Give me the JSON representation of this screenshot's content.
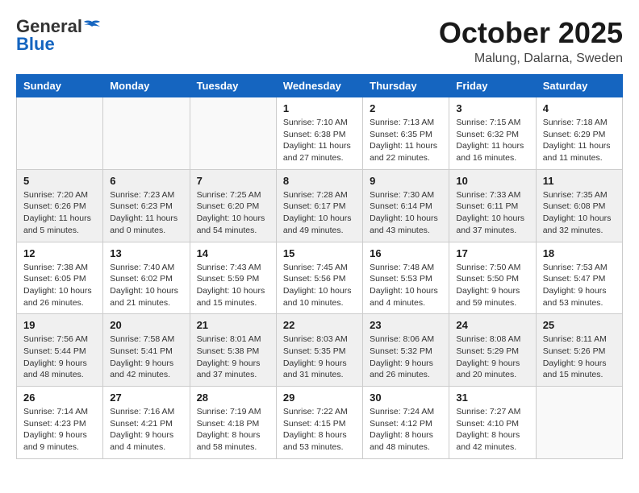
{
  "header": {
    "logo_general": "General",
    "logo_blue": "Blue",
    "month_title": "October 2025",
    "location": "Malung, Dalarna, Sweden"
  },
  "weekdays": [
    "Sunday",
    "Monday",
    "Tuesday",
    "Wednesday",
    "Thursday",
    "Friday",
    "Saturday"
  ],
  "weeks": [
    {
      "shaded": false,
      "days": [
        {
          "num": "",
          "info": ""
        },
        {
          "num": "",
          "info": ""
        },
        {
          "num": "",
          "info": ""
        },
        {
          "num": "1",
          "info": "Sunrise: 7:10 AM\nSunset: 6:38 PM\nDaylight: 11 hours\nand 27 minutes."
        },
        {
          "num": "2",
          "info": "Sunrise: 7:13 AM\nSunset: 6:35 PM\nDaylight: 11 hours\nand 22 minutes."
        },
        {
          "num": "3",
          "info": "Sunrise: 7:15 AM\nSunset: 6:32 PM\nDaylight: 11 hours\nand 16 minutes."
        },
        {
          "num": "4",
          "info": "Sunrise: 7:18 AM\nSunset: 6:29 PM\nDaylight: 11 hours\nand 11 minutes."
        }
      ]
    },
    {
      "shaded": true,
      "days": [
        {
          "num": "5",
          "info": "Sunrise: 7:20 AM\nSunset: 6:26 PM\nDaylight: 11 hours\nand 5 minutes."
        },
        {
          "num": "6",
          "info": "Sunrise: 7:23 AM\nSunset: 6:23 PM\nDaylight: 11 hours\nand 0 minutes."
        },
        {
          "num": "7",
          "info": "Sunrise: 7:25 AM\nSunset: 6:20 PM\nDaylight: 10 hours\nand 54 minutes."
        },
        {
          "num": "8",
          "info": "Sunrise: 7:28 AM\nSunset: 6:17 PM\nDaylight: 10 hours\nand 49 minutes."
        },
        {
          "num": "9",
          "info": "Sunrise: 7:30 AM\nSunset: 6:14 PM\nDaylight: 10 hours\nand 43 minutes."
        },
        {
          "num": "10",
          "info": "Sunrise: 7:33 AM\nSunset: 6:11 PM\nDaylight: 10 hours\nand 37 minutes."
        },
        {
          "num": "11",
          "info": "Sunrise: 7:35 AM\nSunset: 6:08 PM\nDaylight: 10 hours\nand 32 minutes."
        }
      ]
    },
    {
      "shaded": false,
      "days": [
        {
          "num": "12",
          "info": "Sunrise: 7:38 AM\nSunset: 6:05 PM\nDaylight: 10 hours\nand 26 minutes."
        },
        {
          "num": "13",
          "info": "Sunrise: 7:40 AM\nSunset: 6:02 PM\nDaylight: 10 hours\nand 21 minutes."
        },
        {
          "num": "14",
          "info": "Sunrise: 7:43 AM\nSunset: 5:59 PM\nDaylight: 10 hours\nand 15 minutes."
        },
        {
          "num": "15",
          "info": "Sunrise: 7:45 AM\nSunset: 5:56 PM\nDaylight: 10 hours\nand 10 minutes."
        },
        {
          "num": "16",
          "info": "Sunrise: 7:48 AM\nSunset: 5:53 PM\nDaylight: 10 hours\nand 4 minutes."
        },
        {
          "num": "17",
          "info": "Sunrise: 7:50 AM\nSunset: 5:50 PM\nDaylight: 9 hours\nand 59 minutes."
        },
        {
          "num": "18",
          "info": "Sunrise: 7:53 AM\nSunset: 5:47 PM\nDaylight: 9 hours\nand 53 minutes."
        }
      ]
    },
    {
      "shaded": true,
      "days": [
        {
          "num": "19",
          "info": "Sunrise: 7:56 AM\nSunset: 5:44 PM\nDaylight: 9 hours\nand 48 minutes."
        },
        {
          "num": "20",
          "info": "Sunrise: 7:58 AM\nSunset: 5:41 PM\nDaylight: 9 hours\nand 42 minutes."
        },
        {
          "num": "21",
          "info": "Sunrise: 8:01 AM\nSunset: 5:38 PM\nDaylight: 9 hours\nand 37 minutes."
        },
        {
          "num": "22",
          "info": "Sunrise: 8:03 AM\nSunset: 5:35 PM\nDaylight: 9 hours\nand 31 minutes."
        },
        {
          "num": "23",
          "info": "Sunrise: 8:06 AM\nSunset: 5:32 PM\nDaylight: 9 hours\nand 26 minutes."
        },
        {
          "num": "24",
          "info": "Sunrise: 8:08 AM\nSunset: 5:29 PM\nDaylight: 9 hours\nand 20 minutes."
        },
        {
          "num": "25",
          "info": "Sunrise: 8:11 AM\nSunset: 5:26 PM\nDaylight: 9 hours\nand 15 minutes."
        }
      ]
    },
    {
      "shaded": false,
      "days": [
        {
          "num": "26",
          "info": "Sunrise: 7:14 AM\nSunset: 4:23 PM\nDaylight: 9 hours\nand 9 minutes."
        },
        {
          "num": "27",
          "info": "Sunrise: 7:16 AM\nSunset: 4:21 PM\nDaylight: 9 hours\nand 4 minutes."
        },
        {
          "num": "28",
          "info": "Sunrise: 7:19 AM\nSunset: 4:18 PM\nDaylight: 8 hours\nand 58 minutes."
        },
        {
          "num": "29",
          "info": "Sunrise: 7:22 AM\nSunset: 4:15 PM\nDaylight: 8 hours\nand 53 minutes."
        },
        {
          "num": "30",
          "info": "Sunrise: 7:24 AM\nSunset: 4:12 PM\nDaylight: 8 hours\nand 48 minutes."
        },
        {
          "num": "31",
          "info": "Sunrise: 7:27 AM\nSunset: 4:10 PM\nDaylight: 8 hours\nand 42 minutes."
        },
        {
          "num": "",
          "info": ""
        }
      ]
    }
  ]
}
